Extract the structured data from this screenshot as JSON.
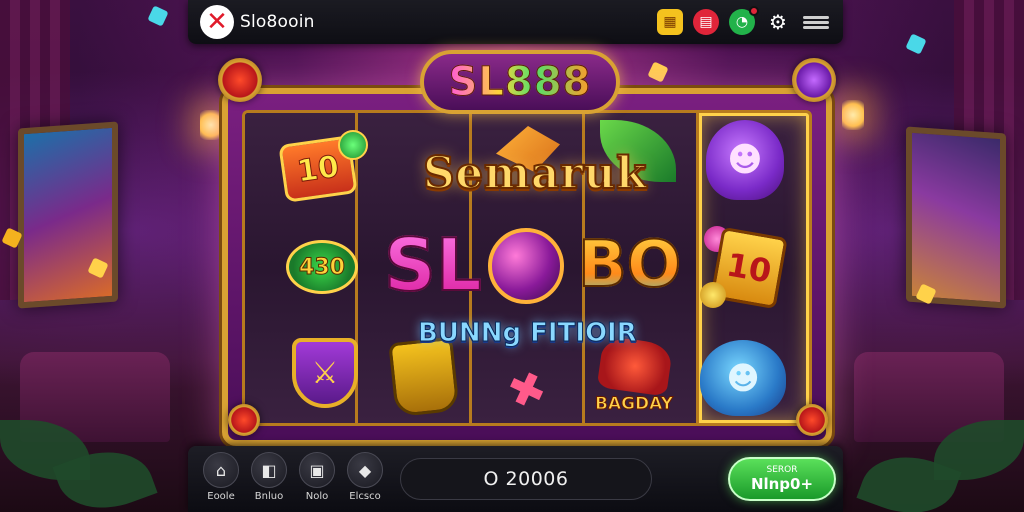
{
  "header": {
    "brand": "Slo8ooin",
    "logo_icon": "x-mark-icon",
    "icons": [
      "gift-icon",
      "bag-icon",
      "chat-icon",
      "settings-icon",
      "menu-icon"
    ]
  },
  "machine": {
    "title": "SL888",
    "headline": "Semaruk",
    "big_left": "SL",
    "big_right": "BO",
    "subline": "BUNNg FITIOIR",
    "badge": "BAGDAY",
    "symbols": {
      "coin_top": "10",
      "chip": "430",
      "card": "10"
    }
  },
  "bottom": {
    "nav": [
      {
        "label": "Eoole",
        "icon": "home-icon"
      },
      {
        "label": "Bnluo",
        "icon": "bag-icon"
      },
      {
        "label": "Nolo",
        "icon": "gift-icon"
      },
      {
        "label": "Elcsco",
        "icon": "diamond-icon"
      }
    ],
    "balance": "O 20006",
    "spin": {
      "top": "SEROR",
      "main": "Nlnp0+"
    }
  },
  "colors": {
    "accent_gold": "#d9a233",
    "spin_green": "#1a9a2a",
    "brand_red": "#e01a2a"
  }
}
